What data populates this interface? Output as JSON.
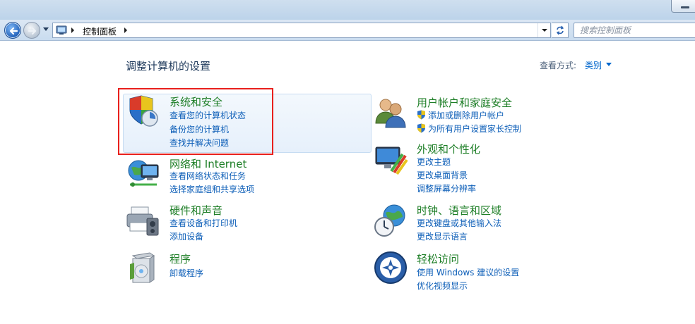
{
  "address": {
    "crumb": "控制面板",
    "search_placeholder": "搜索控制面板"
  },
  "content": {
    "heading": "调整计算机的设置",
    "view_by_label": "查看方式:",
    "view_by_value": "类别"
  },
  "categories": [
    {
      "title": "系统和安全",
      "links": [
        "查看您的计算机状态",
        "备份您的计算机",
        "查找并解决问题"
      ],
      "icon": "system-security-shield-icon"
    },
    {
      "title": "网络和 Internet",
      "links": [
        "查看网络状态和任务",
        "选择家庭组和共享选项"
      ],
      "icon": "network-globe-icon"
    },
    {
      "title": "硬件和声音",
      "links": [
        "查看设备和打印机",
        "添加设备"
      ],
      "icon": "printer-hardware-icon"
    },
    {
      "title": "程序",
      "links": [
        "卸载程序"
      ],
      "icon": "programs-box-icon"
    },
    {
      "title": "用户帐户和家庭安全",
      "links": [
        "添加或删除用户帐户",
        "为所有用户设置家长控制"
      ],
      "icon": "users-icon"
    },
    {
      "title": "外观和个性化",
      "links": [
        "更改主题",
        "更改桌面背景",
        "调整屏幕分辨率"
      ],
      "icon": "monitor-paint-icon"
    },
    {
      "title": "时钟、语言和区域",
      "links": [
        "更改键盘或其他输入法",
        "更改显示语言"
      ],
      "icon": "clock-globe-icon"
    },
    {
      "title": "轻松访问",
      "links": [
        "使用 Windows 建议的设置",
        "优化视频显示"
      ],
      "icon": "ease-of-access-icon"
    }
  ],
  "colors": {
    "category_title": "#1d7e26",
    "link": "#0e5fb8",
    "highlight_border": "#e8201d"
  }
}
